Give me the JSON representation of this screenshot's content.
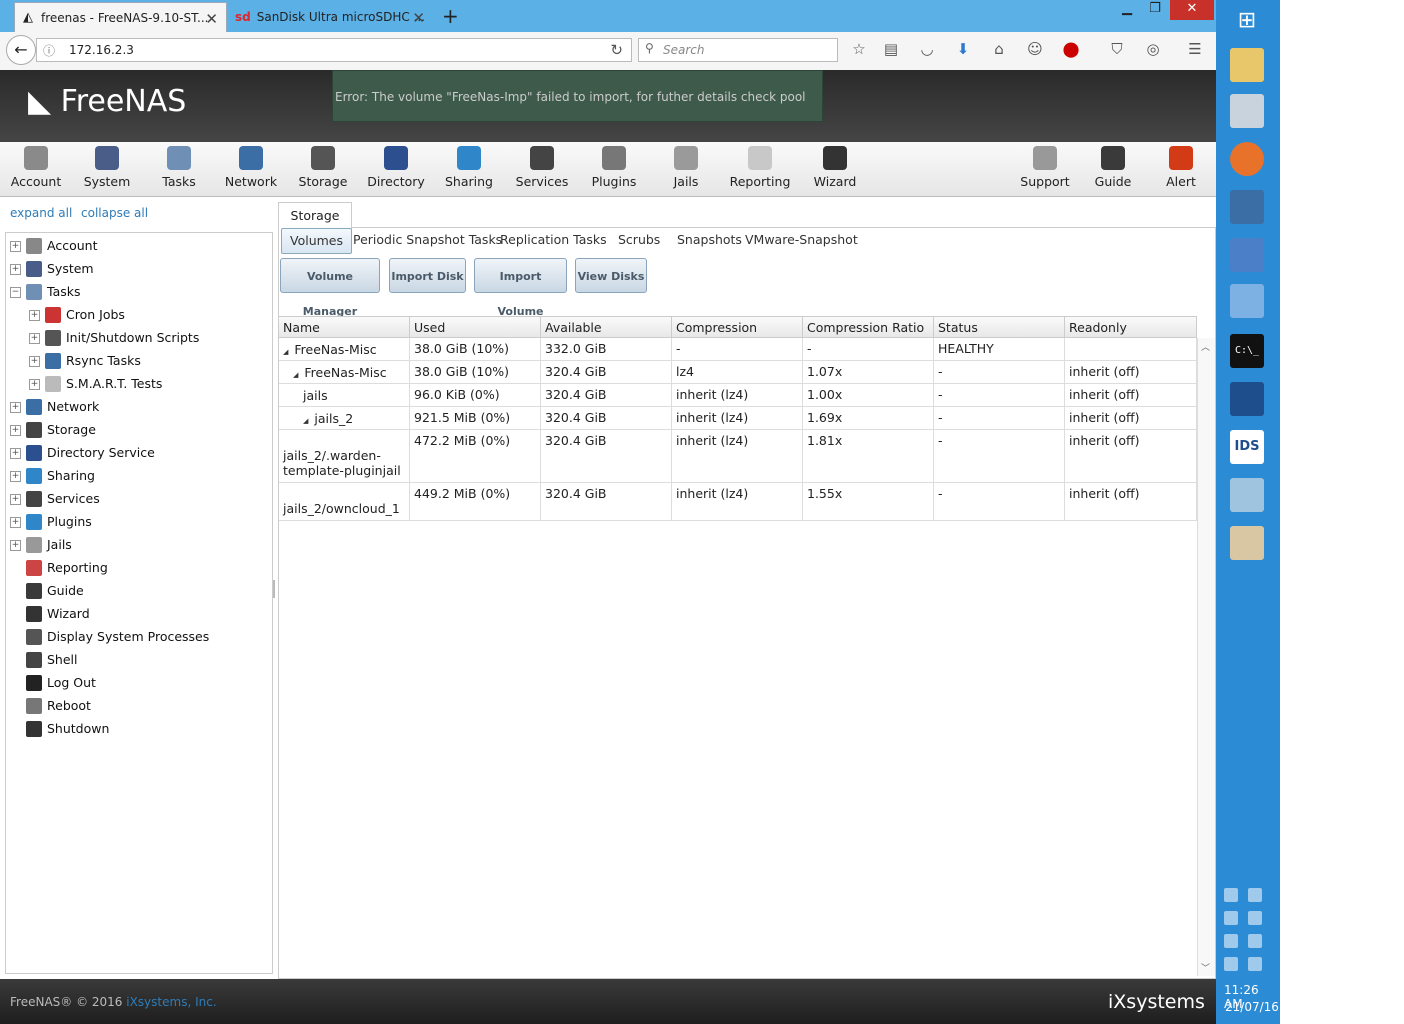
{
  "browser": {
    "tabs": [
      {
        "title": "freenas - FreeNAS-9.10-ST..."
      },
      {
        "title": "SanDisk Ultra microSDHC ..."
      }
    ],
    "tab2_favicon": "sd",
    "new_tab_label": "+",
    "url": "172.16.2.3",
    "search_placeholder": "Search",
    "window_controls": {
      "minimize": "▁",
      "restore": "❐",
      "close": "✕"
    }
  },
  "app": {
    "logo_text": "FreeNAS",
    "error_message": "Error: The volume \"FreeNas-Imp\" failed to import, for futher details check pool status",
    "toolbar": [
      {
        "label": "Account",
        "icon": "account-icon",
        "color": "#8a8a8a"
      },
      {
        "label": "System",
        "icon": "system-icon",
        "color": "#4a5d88"
      },
      {
        "label": "Tasks",
        "icon": "tasks-icon",
        "color": "#6f8fb5"
      },
      {
        "label": "Network",
        "icon": "network-icon",
        "color": "#3a6ea5"
      },
      {
        "label": "Storage",
        "icon": "storage-icon",
        "color": "#555555"
      },
      {
        "label": "Directory",
        "icon": "directory-icon",
        "color": "#2b4f8f"
      },
      {
        "label": "Sharing",
        "icon": "sharing-icon",
        "color": "#2f86c9"
      },
      {
        "label": "Services",
        "icon": "services-icon",
        "color": "#444444"
      },
      {
        "label": "Plugins",
        "icon": "plugins-icon",
        "color": "#777777"
      },
      {
        "label": "Jails",
        "icon": "jails-icon",
        "color": "#9a9a9a"
      },
      {
        "label": "Reporting",
        "icon": "reporting-icon",
        "color": "#c8c8c8"
      },
      {
        "label": "Wizard",
        "icon": "wizard-icon",
        "color": "#333333"
      },
      {
        "label": "Support",
        "icon": "support-icon",
        "color": "#999999"
      },
      {
        "label": "Guide",
        "icon": "guide-icon",
        "color": "#3a3a3a"
      },
      {
        "label": "Alert",
        "icon": "alert-icon",
        "color": "#d23b16"
      }
    ],
    "sidebar": {
      "expand_all": "expand all",
      "collapse_all": "collapse all",
      "items": [
        {
          "label": "Account",
          "level": 0,
          "toggle": "+"
        },
        {
          "label": "System",
          "level": 0,
          "toggle": "+"
        },
        {
          "label": "Tasks",
          "level": 0,
          "toggle": "−"
        },
        {
          "label": "Cron Jobs",
          "level": 1,
          "toggle": "+"
        },
        {
          "label": "Init/Shutdown Scripts",
          "level": 1,
          "toggle": "+"
        },
        {
          "label": "Rsync Tasks",
          "level": 1,
          "toggle": "+"
        },
        {
          "label": "S.M.A.R.T. Tests",
          "level": 1,
          "toggle": "+"
        },
        {
          "label": "Network",
          "level": 0,
          "toggle": "+"
        },
        {
          "label": "Storage",
          "level": 0,
          "toggle": "+"
        },
        {
          "label": "Directory Service",
          "level": 0,
          "toggle": "+"
        },
        {
          "label": "Sharing",
          "level": 0,
          "toggle": "+"
        },
        {
          "label": "Services",
          "level": 0,
          "toggle": "+"
        },
        {
          "label": "Plugins",
          "level": 0,
          "toggle": "+"
        },
        {
          "label": "Jails",
          "level": 0,
          "toggle": "+"
        },
        {
          "label": "Reporting",
          "level": 0,
          "toggle": ""
        },
        {
          "label": "Guide",
          "level": 0,
          "toggle": ""
        },
        {
          "label": "Wizard",
          "level": 0,
          "toggle": ""
        },
        {
          "label": "Display System Processes",
          "level": 0,
          "toggle": ""
        },
        {
          "label": "Shell",
          "level": 0,
          "toggle": ""
        },
        {
          "label": "Log Out",
          "level": 0,
          "toggle": ""
        },
        {
          "label": "Reboot",
          "level": 0,
          "toggle": ""
        },
        {
          "label": "Shutdown",
          "level": 0,
          "toggle": ""
        }
      ]
    },
    "main": {
      "tab": "Storage",
      "subtabs": [
        "Volumes",
        "Periodic Snapshot Tasks",
        "Replication Tasks",
        "Scrubs",
        "Snapshots",
        "VMware-Snapshot"
      ],
      "buttons": [
        "Volume Manager",
        "Import Disk",
        "Import Volume",
        "View Disks"
      ],
      "columns": [
        "Name",
        "Used",
        "Available",
        "Compression",
        "Compression Ratio",
        "Status",
        "Readonly"
      ],
      "rows": [
        {
          "name": "FreeNas-Misc",
          "indent": 0,
          "arrow": "◢",
          "used": "38.0 GiB (10%)",
          "available": "332.0 GiB",
          "compression": "-",
          "ratio": "-",
          "status": "HEALTHY",
          "readonly": ""
        },
        {
          "name": "FreeNas-Misc",
          "indent": 1,
          "arrow": "◢",
          "used": "38.0 GiB (10%)",
          "available": "320.4 GiB",
          "compression": "lz4",
          "ratio": "1.07x",
          "status": "-",
          "readonly": "inherit (off)"
        },
        {
          "name": "jails",
          "indent": 2,
          "arrow": "",
          "used": "96.0 KiB (0%)",
          "available": "320.4 GiB",
          "compression": "inherit (lz4)",
          "ratio": "1.00x",
          "status": "-",
          "readonly": "inherit (off)"
        },
        {
          "name": "jails_2",
          "indent": 2,
          "arrow": "◢",
          "used": "921.5 MiB (0%)",
          "available": "320.4 GiB",
          "compression": "inherit (lz4)",
          "ratio": "1.69x",
          "status": "-",
          "readonly": "inherit (off)"
        },
        {
          "name": "jails_2/.warden-\ntemplate-pluginjail",
          "indent": 3,
          "arrow": "",
          "used": "472.2 MiB (0%)",
          "available": "320.4 GiB",
          "compression": "inherit (lz4)",
          "ratio": "1.81x",
          "status": "-",
          "readonly": "inherit (off)"
        },
        {
          "name": "jails_2/owncloud_1",
          "indent": 3,
          "arrow": "",
          "used": "449.2 MiB (0%)",
          "available": "320.4 GiB",
          "compression": "inherit (lz4)",
          "ratio": "1.55x",
          "status": "-",
          "readonly": "inherit (off)"
        }
      ]
    },
    "footer": {
      "copyright": "FreeNAS® © 2016 ",
      "company": "iXsystems, Inc.",
      "brand": "iXsystems"
    }
  },
  "taskbar": {
    "time": "11:26 AM",
    "date": "21/07/16",
    "cmd_label": "C:\\_",
    "ids_label": "IDS",
    "icons": [
      "windows-start-icon",
      "file-explorer-icon",
      "server-manager-icon",
      "firefox-icon",
      "powershell-icon",
      "remote-desktop-icon",
      "rdp-client-icon",
      "cmd-icon",
      "virtualbox-icon",
      "ids-icon",
      "notepad-icon",
      "paint-icon"
    ],
    "accent": "#2b8bd5"
  }
}
